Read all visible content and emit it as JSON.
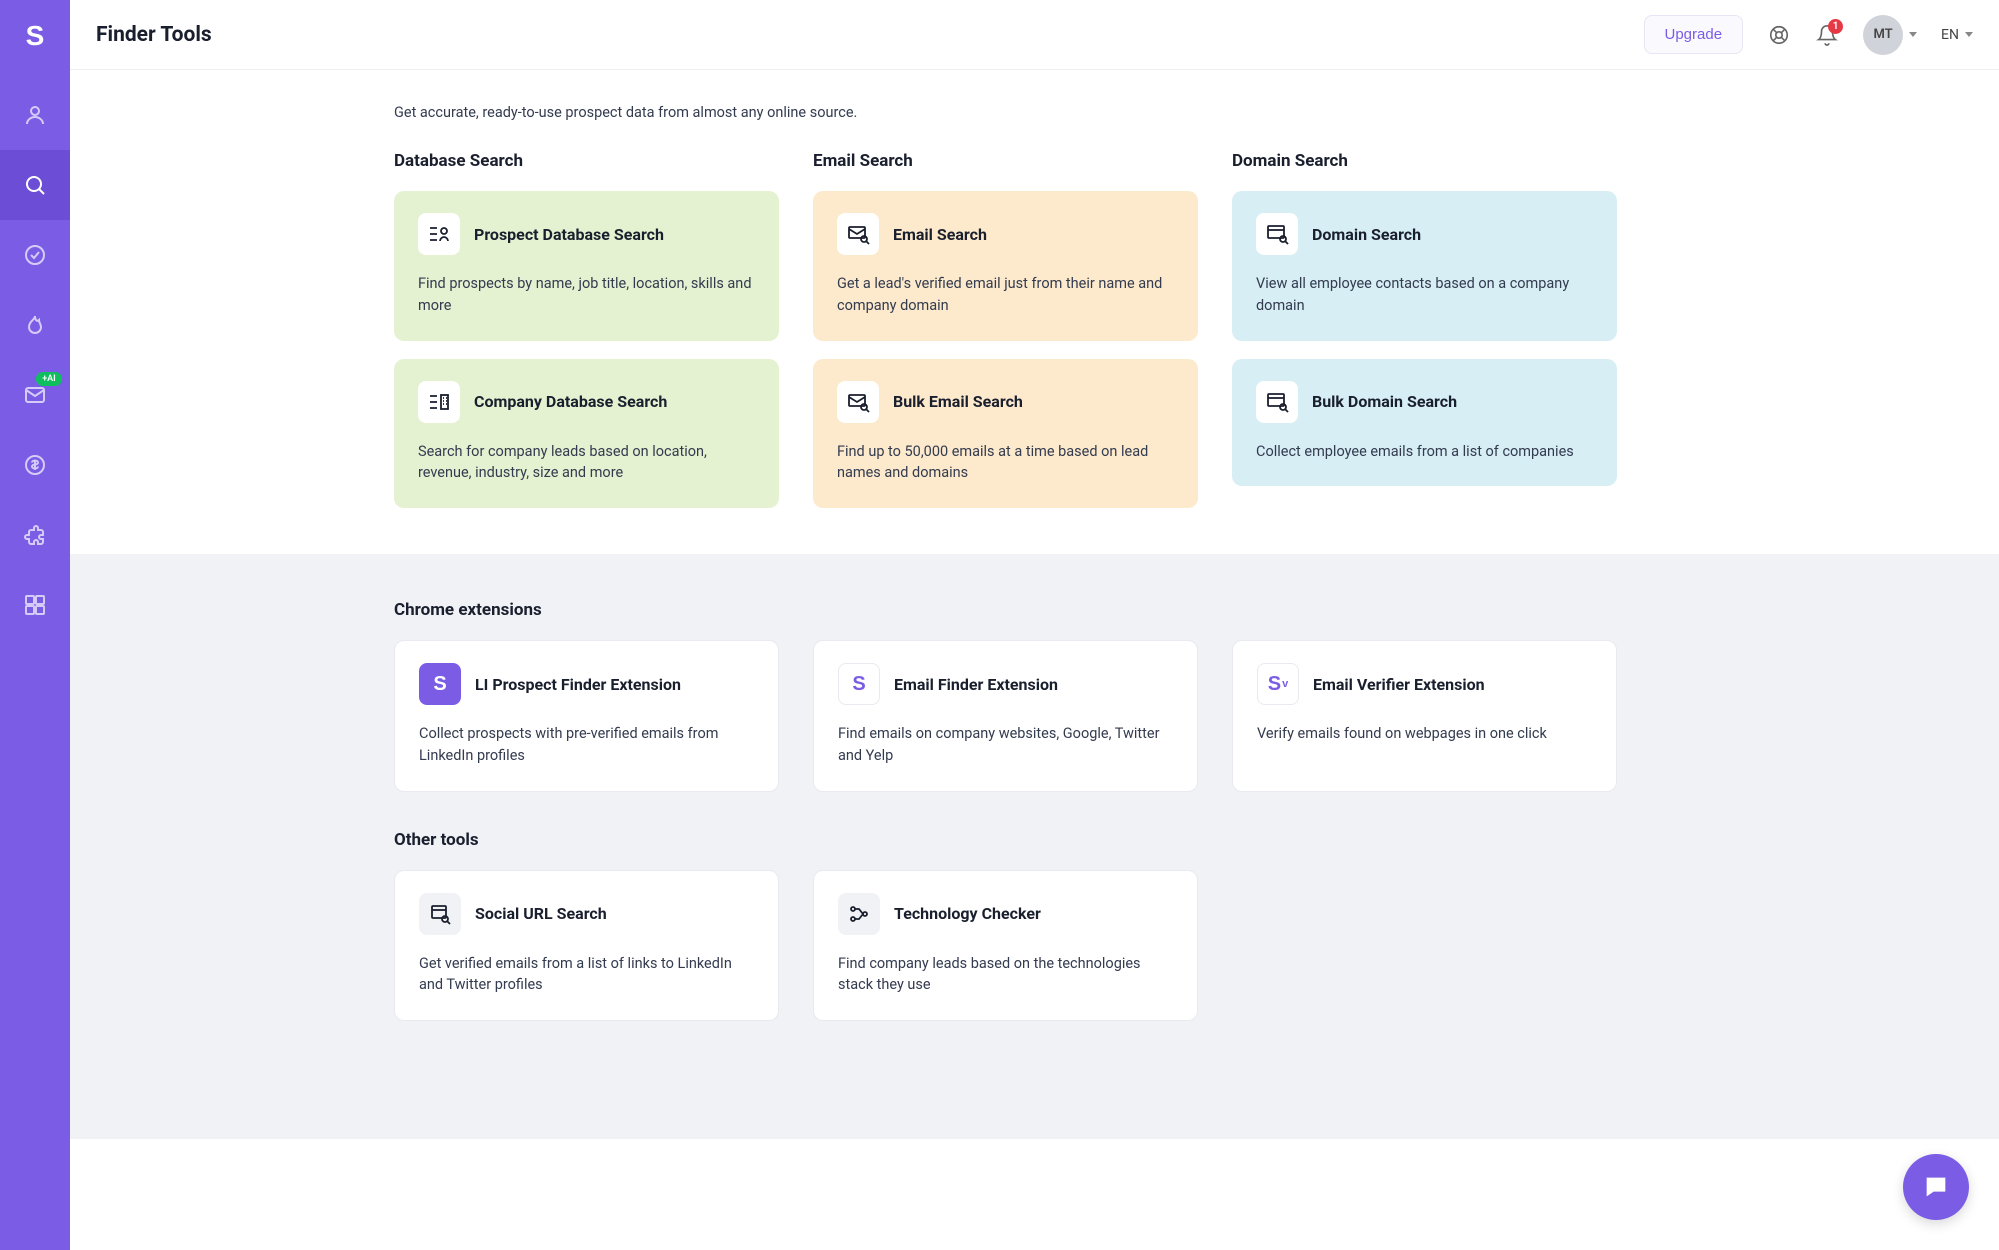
{
  "header": {
    "title": "Finder Tools",
    "upgrade_label": "Upgrade",
    "lang": "EN",
    "avatar_initials": "MT",
    "notif_count": "1"
  },
  "sidebar": {
    "nav_badge": "+AI"
  },
  "intro": "Get accurate, ready-to-use prospect data from almost any online source.",
  "columns": [
    {
      "title": "Database Search",
      "cards": [
        {
          "title": "Prospect Database Search",
          "desc": "Find prospects by name, job title, location, skills and more"
        },
        {
          "title": "Company Database Search",
          "desc": "Search for company leads based on location, revenue, industry, size and more"
        }
      ]
    },
    {
      "title": "Email Search",
      "cards": [
        {
          "title": "Email Search",
          "desc": "Get a lead's verified email just from their name and company domain"
        },
        {
          "title": "Bulk Email Search",
          "desc": "Find up to 50,000 emails at a time based on lead names and domains"
        }
      ]
    },
    {
      "title": "Domain Search",
      "cards": [
        {
          "title": "Domain Search",
          "desc": "View all employee contacts based on a company domain"
        },
        {
          "title": "Bulk Domain Search",
          "desc": "Collect employee emails from a list of companies"
        }
      ]
    }
  ],
  "extensions": {
    "title": "Chrome extensions",
    "cards": [
      {
        "title": "LI Prospect Finder Extension",
        "desc": "Collect prospects with pre-verified emails from LinkedIn profiles"
      },
      {
        "title": "Email Finder Extension",
        "desc": "Find emails on company websites, Google, Twitter and Yelp"
      },
      {
        "title": "Email Verifier Extension",
        "desc": "Verify emails found on webpages in one click"
      }
    ]
  },
  "other": {
    "title": "Other tools",
    "cards": [
      {
        "title": "Social URL Search",
        "desc": "Get verified emails from a list of links to LinkedIn and Twitter profiles"
      },
      {
        "title": "Technology Checker",
        "desc": "Find company leads based on the technologies stack they use"
      }
    ]
  }
}
